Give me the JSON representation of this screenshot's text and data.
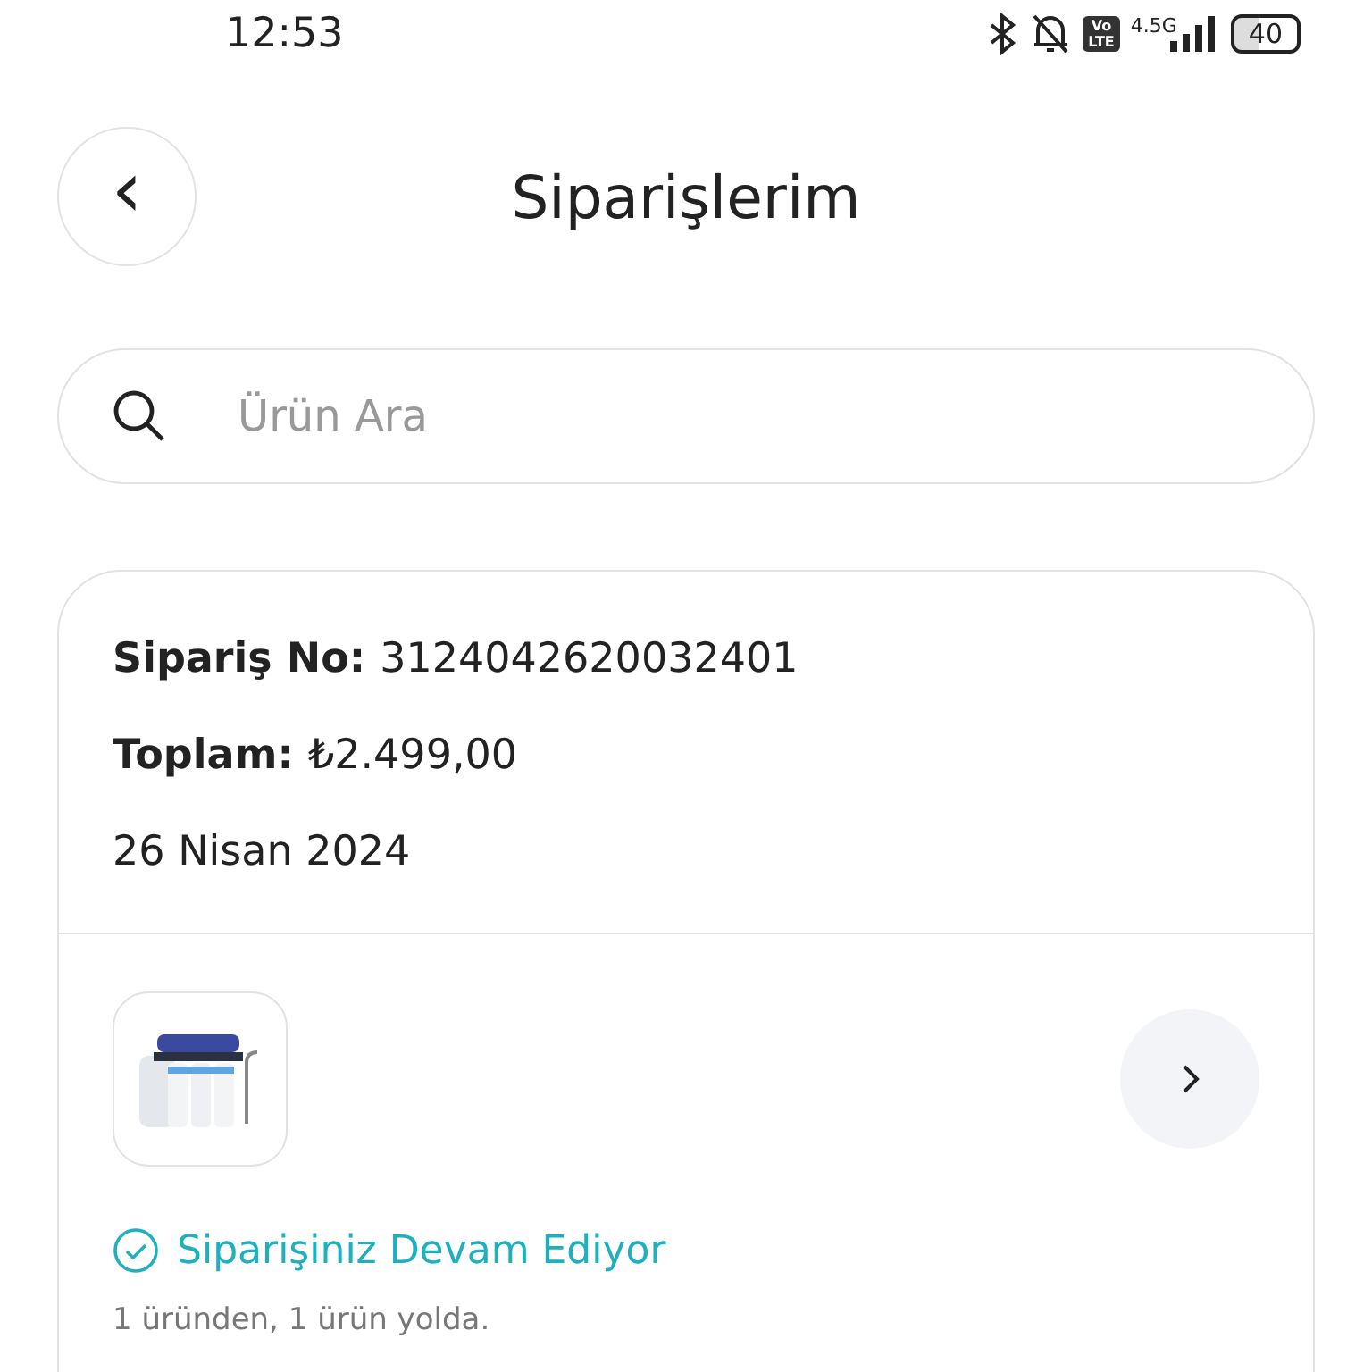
{
  "status_bar": {
    "time": "12:53",
    "volte": [
      "Vo",
      "LTE"
    ],
    "network": "4.5G",
    "battery": "40"
  },
  "header": {
    "back": "‹",
    "title": "Siparişlerim"
  },
  "search": {
    "placeholder": "Ürün Ara"
  },
  "order": {
    "fields": [
      {
        "label": "Sipariş No:",
        "value": "3124042620032401"
      },
      {
        "label": "Toplam:",
        "value": "₺2.499,00"
      },
      {
        "value": "26 Nisan 2024"
      }
    ],
    "status": "Siparişiniz Devam Ediyor",
    "summary": "1 üründen, 1 ürün yolda."
  }
}
